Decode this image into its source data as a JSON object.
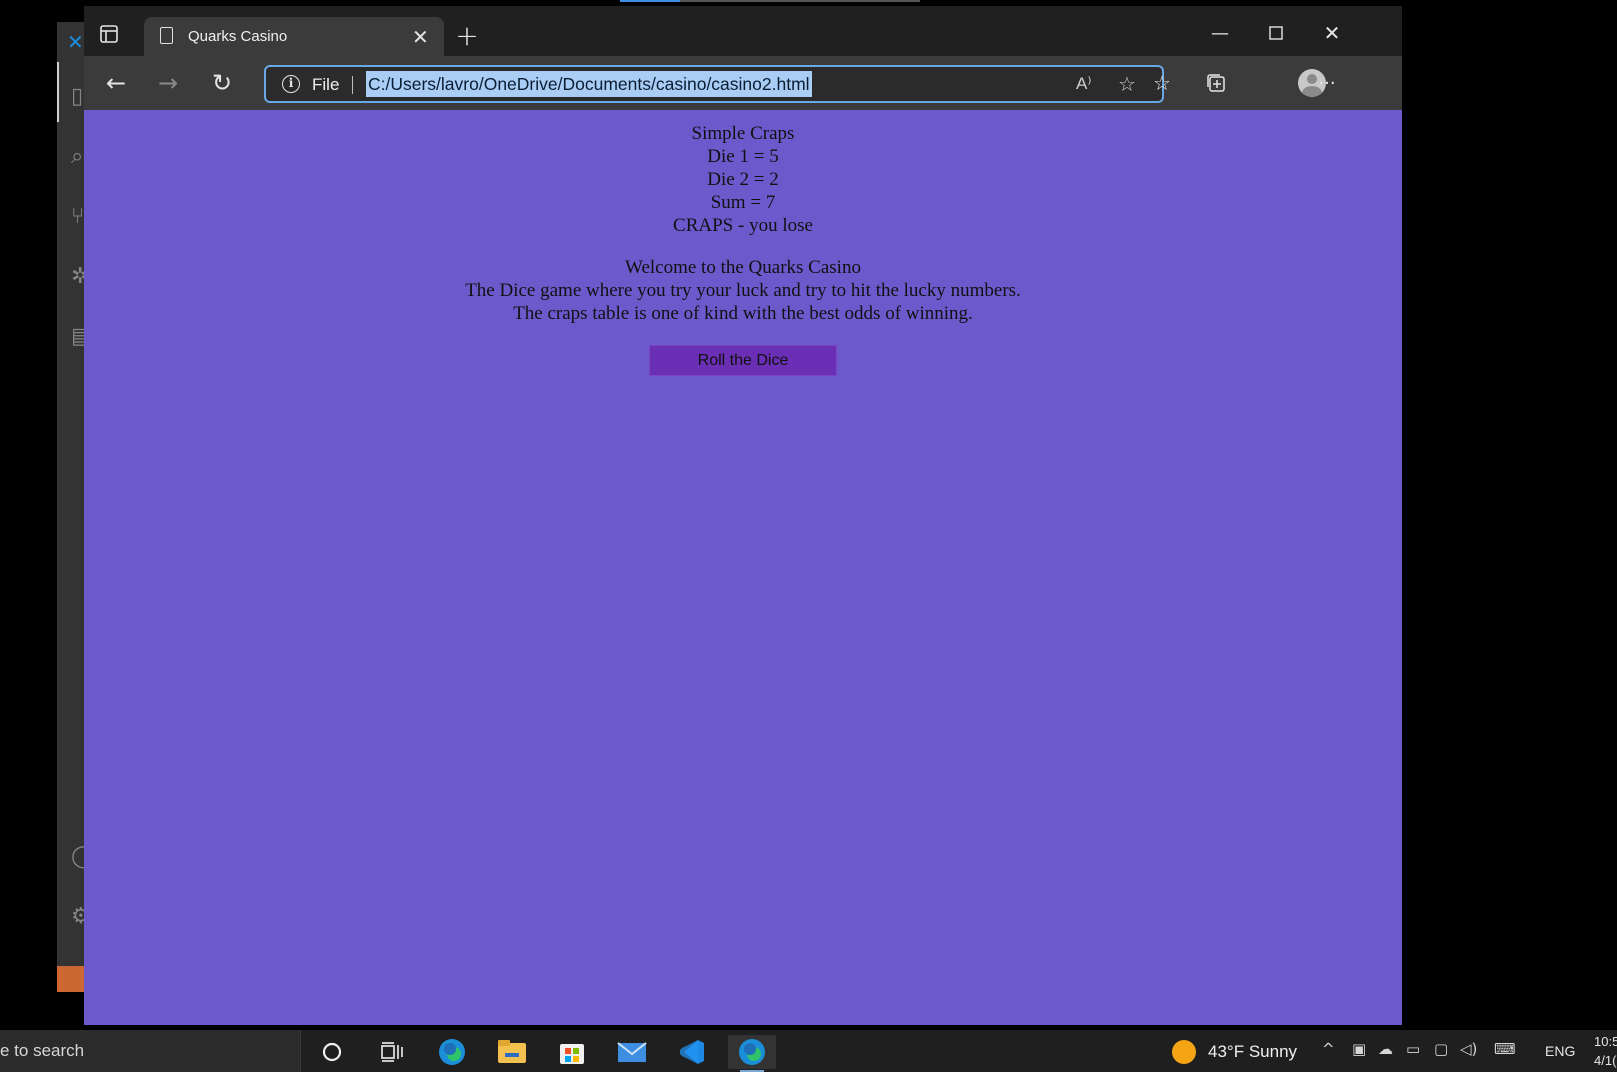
{
  "browser": {
    "tab": {
      "title": "Quarks Casino"
    },
    "address": {
      "scheme_label": "File",
      "url": "C:/Users/lavro/OneDrive/Documents/casino/casino2.html"
    }
  },
  "page": {
    "game_lines": [
      "Simple Craps",
      "Die 1 = 5",
      "Die 2 = 2",
      "Sum = 7",
      "CRAPS - you lose"
    ],
    "welcome_lines": [
      "Welcome to the Quarks Casino",
      "The Dice game where you try your luck and try to hit the lucky numbers.",
      "The craps table is one of kind with the best odds of winning."
    ],
    "roll_button": "Roll the Dice",
    "background_color": "#6c5acd",
    "button_color": "#6a2fb4"
  },
  "taskbar": {
    "search_text": "e to search",
    "weather": "43°F  Sunny",
    "language": "ENG",
    "time": "10:5",
    "date": "4/1("
  }
}
